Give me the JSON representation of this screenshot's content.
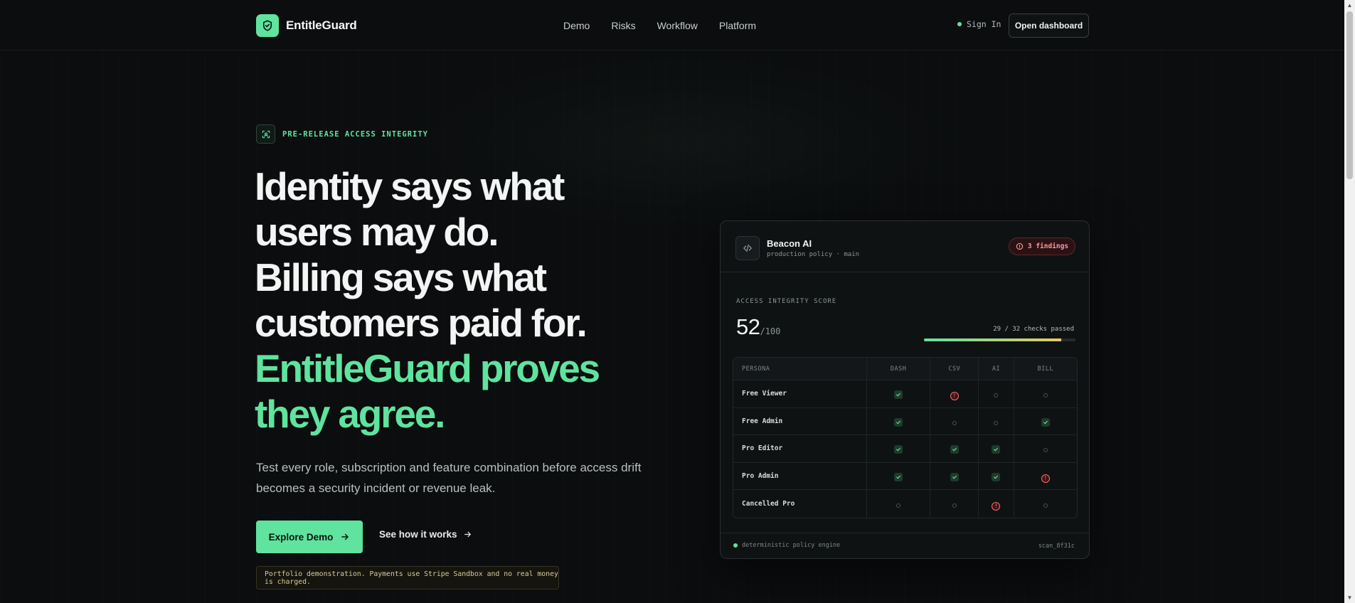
{
  "nav": {
    "brand": "EntitleGuard",
    "links": [
      "Demo",
      "Risks",
      "Workflow",
      "Platform"
    ],
    "sign_in": "Sign In",
    "open_dashboard": "Open dashboard"
  },
  "hero": {
    "eyebrow": "PRE-RELEASE ACCESS INTEGRITY",
    "headline_lines": [
      "Identity says what",
      "users may do.",
      "Billing says what",
      "customers paid for."
    ],
    "headline_accent_lines": [
      "EntitleGuard proves",
      "they agree."
    ],
    "subcopy": "Test every role, subscription and feature combination before access drift becomes a security incident or revenue leak.",
    "cta_primary": "Explore Demo",
    "cta_secondary": "See how it works",
    "notice": "Portfolio demonstration. Payments use Stripe Sandbox and no real money is charged."
  },
  "card": {
    "project": "Beacon AI",
    "project_sub": "production policy · main",
    "findings": "3 findings",
    "score_label": "ACCESS INTEGRITY SCORE",
    "score": "52",
    "score_max": "/100",
    "checks": "29 / 32 checks passed",
    "progress_fraction": 0.906,
    "columns": [
      "PERSONA",
      "DASH",
      "CSV",
      "AI",
      "BILL"
    ],
    "rows": [
      {
        "persona": "Free Viewer",
        "cells": [
          "ok",
          "bad",
          "na",
          "na"
        ]
      },
      {
        "persona": "Free Admin",
        "cells": [
          "ok",
          "na",
          "na",
          "ok"
        ]
      },
      {
        "persona": "Pro Editor",
        "cells": [
          "ok",
          "ok",
          "ok",
          "na"
        ]
      },
      {
        "persona": "Pro Admin",
        "cells": [
          "ok",
          "ok",
          "ok",
          "bad"
        ]
      },
      {
        "persona": "Cancelled Pro",
        "cells": [
          "na",
          "na",
          "bad",
          "na"
        ]
      }
    ],
    "engine": "deterministic policy engine",
    "scan_id": "scan_8f31c"
  },
  "colors": {
    "accent": "#5fe39e",
    "danger": "#ff6b6b",
    "background": "#0b0d0e"
  }
}
